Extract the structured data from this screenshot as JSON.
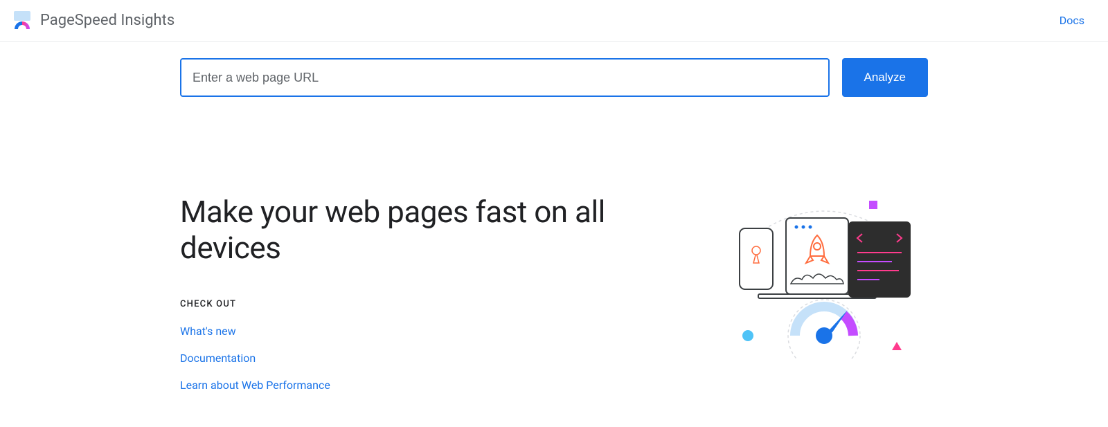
{
  "header": {
    "title": "PageSpeed Insights",
    "docs_link": "Docs"
  },
  "search": {
    "placeholder": "Enter a web page URL",
    "value": "",
    "analyze_label": "Analyze"
  },
  "hero": {
    "heading": "Make your web pages fast on all devices",
    "checkout_label": "CHECK OUT",
    "links": [
      "What's new",
      "Documentation",
      "Learn about Web Performance"
    ]
  }
}
